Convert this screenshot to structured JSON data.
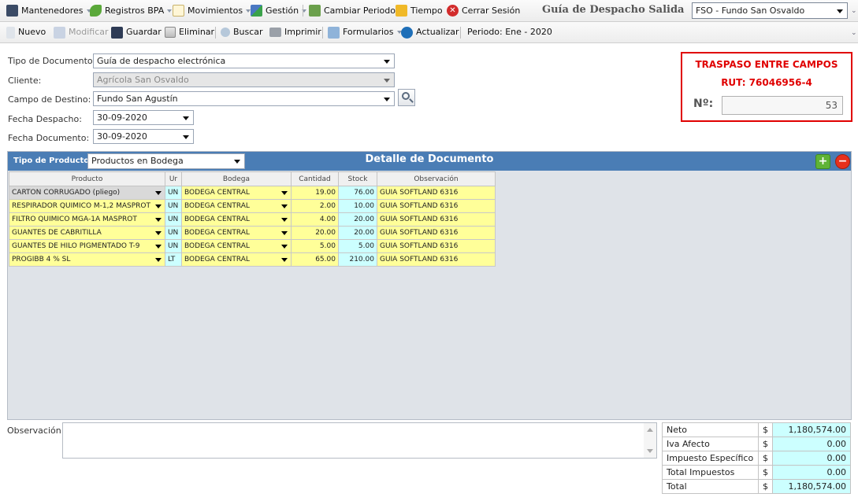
{
  "menu": {
    "mantenedores": "Mantenedores",
    "registros_bpa": "Registros BPA",
    "movimientos": "Movimientos",
    "gestion": "Gestión",
    "cambiar_periodo": "Cambiar Periodo",
    "tiempo": "Tiempo",
    "cerrar_sesion": "Cerrar Sesión"
  },
  "app_title": "Guía de Despacho Salida",
  "company_select": "FSO - Fundo San Osvaldo",
  "toolbar": {
    "nuevo": "Nuevo",
    "modificar": "Modificar",
    "guardar": "Guardar",
    "eliminar": "Eliminar",
    "buscar": "Buscar",
    "imprimir": "Imprimir",
    "formularios": "Formularios",
    "actualizar": "Actualizar",
    "periodo": "Periodo: Ene - 2020"
  },
  "form": {
    "tipo_documento_label": "Tipo de Documento:",
    "tipo_documento_value": "Guía de despacho electrónica",
    "cliente_label": "Cliente:",
    "cliente_value": "Agrícola San Osvaldo",
    "campo_destino_label": "Campo de Destino:",
    "campo_destino_value": "Fundo San Agustín",
    "fecha_despacho_label": "Fecha Despacho:",
    "fecha_despacho_value": "30-09-2020",
    "fecha_documento_label": "Fecha Documento:",
    "fecha_documento_value": "30-09-2020"
  },
  "traspaso": {
    "title": "TRASPASO ENTRE CAMPOS",
    "rut": "RUT: 76046956-4",
    "numero_label": "Nº:",
    "numero_value": "53"
  },
  "detail": {
    "tipo_producto_label": "Tipo de Producto:",
    "tipo_producto_value": "Productos en Bodega",
    "title": "Detalle de Documento",
    "add_symbol": "+",
    "remove_symbol": "−",
    "columns": [
      "Producto",
      "Ur",
      "Bodega",
      "Cantidad",
      "Stock",
      "Observación"
    ],
    "rows": [
      {
        "producto": "CARTON CORRUGADO (pliego)",
        "unidad": "UN",
        "bodega": "BODEGA CENTRAL",
        "cantidad": "19.00",
        "stock": "76.00",
        "observacion": "GUIA SOFTLAND 6316"
      },
      {
        "producto": "RESPIRADOR QUIMICO M-1,2 MASPROT",
        "unidad": "UN",
        "bodega": "BODEGA CENTRAL",
        "cantidad": "2.00",
        "stock": "10.00",
        "observacion": "GUIA SOFTLAND 6316"
      },
      {
        "producto": "FILTRO QUIMICO MGA-1A MASPROT",
        "unidad": "UN",
        "bodega": "BODEGA CENTRAL",
        "cantidad": "4.00",
        "stock": "20.00",
        "observacion": "GUIA SOFTLAND 6316"
      },
      {
        "producto": "GUANTES DE CABRITILLA",
        "unidad": "UN",
        "bodega": "BODEGA CENTRAL",
        "cantidad": "20.00",
        "stock": "20.00",
        "observacion": "GUIA SOFTLAND 6316"
      },
      {
        "producto": "GUANTES DE HILO PIGMENTADO T-9",
        "unidad": "UN",
        "bodega": "BODEGA CENTRAL",
        "cantidad": "5.00",
        "stock": "5.00",
        "observacion": "GUIA SOFTLAND 6316"
      },
      {
        "producto": "PROGIBB 4 % SL",
        "unidad": "LT",
        "bodega": "BODEGA CENTRAL",
        "cantidad": "65.00",
        "stock": "210.00",
        "observacion": "GUIA SOFTLAND 6316"
      }
    ]
  },
  "observacion_label": "Observación:",
  "totals": [
    {
      "label": "Neto",
      "currency": "$",
      "value": "1,180,574.00"
    },
    {
      "label": "Iva Afecto",
      "currency": "$",
      "value": "0.00"
    },
    {
      "label": "Impuesto Específico",
      "currency": "$",
      "value": "0.00"
    },
    {
      "label": "Total Impuestos",
      "currency": "$",
      "value": "0.00"
    },
    {
      "label": "Total",
      "currency": "$",
      "value": "1,180,574.00"
    }
  ],
  "icons": [
    "grid-icon",
    "leaf-icon",
    "document-icon",
    "tools-icon",
    "refresh-calendar-icon",
    "folder-icon",
    "close-circle-icon",
    "new-document-icon",
    "edit-icon",
    "save-icon",
    "delete-icon",
    "search-icon",
    "printer-icon",
    "forms-icon",
    "refresh-icon",
    "magnifier-icon",
    "add-icon",
    "remove-icon"
  ],
  "colors": {
    "header_blue": "#4a7db5",
    "required_yellow": "#ffff99",
    "readonly_cyan": "#ccffff",
    "alert_red": "#e00000"
  }
}
